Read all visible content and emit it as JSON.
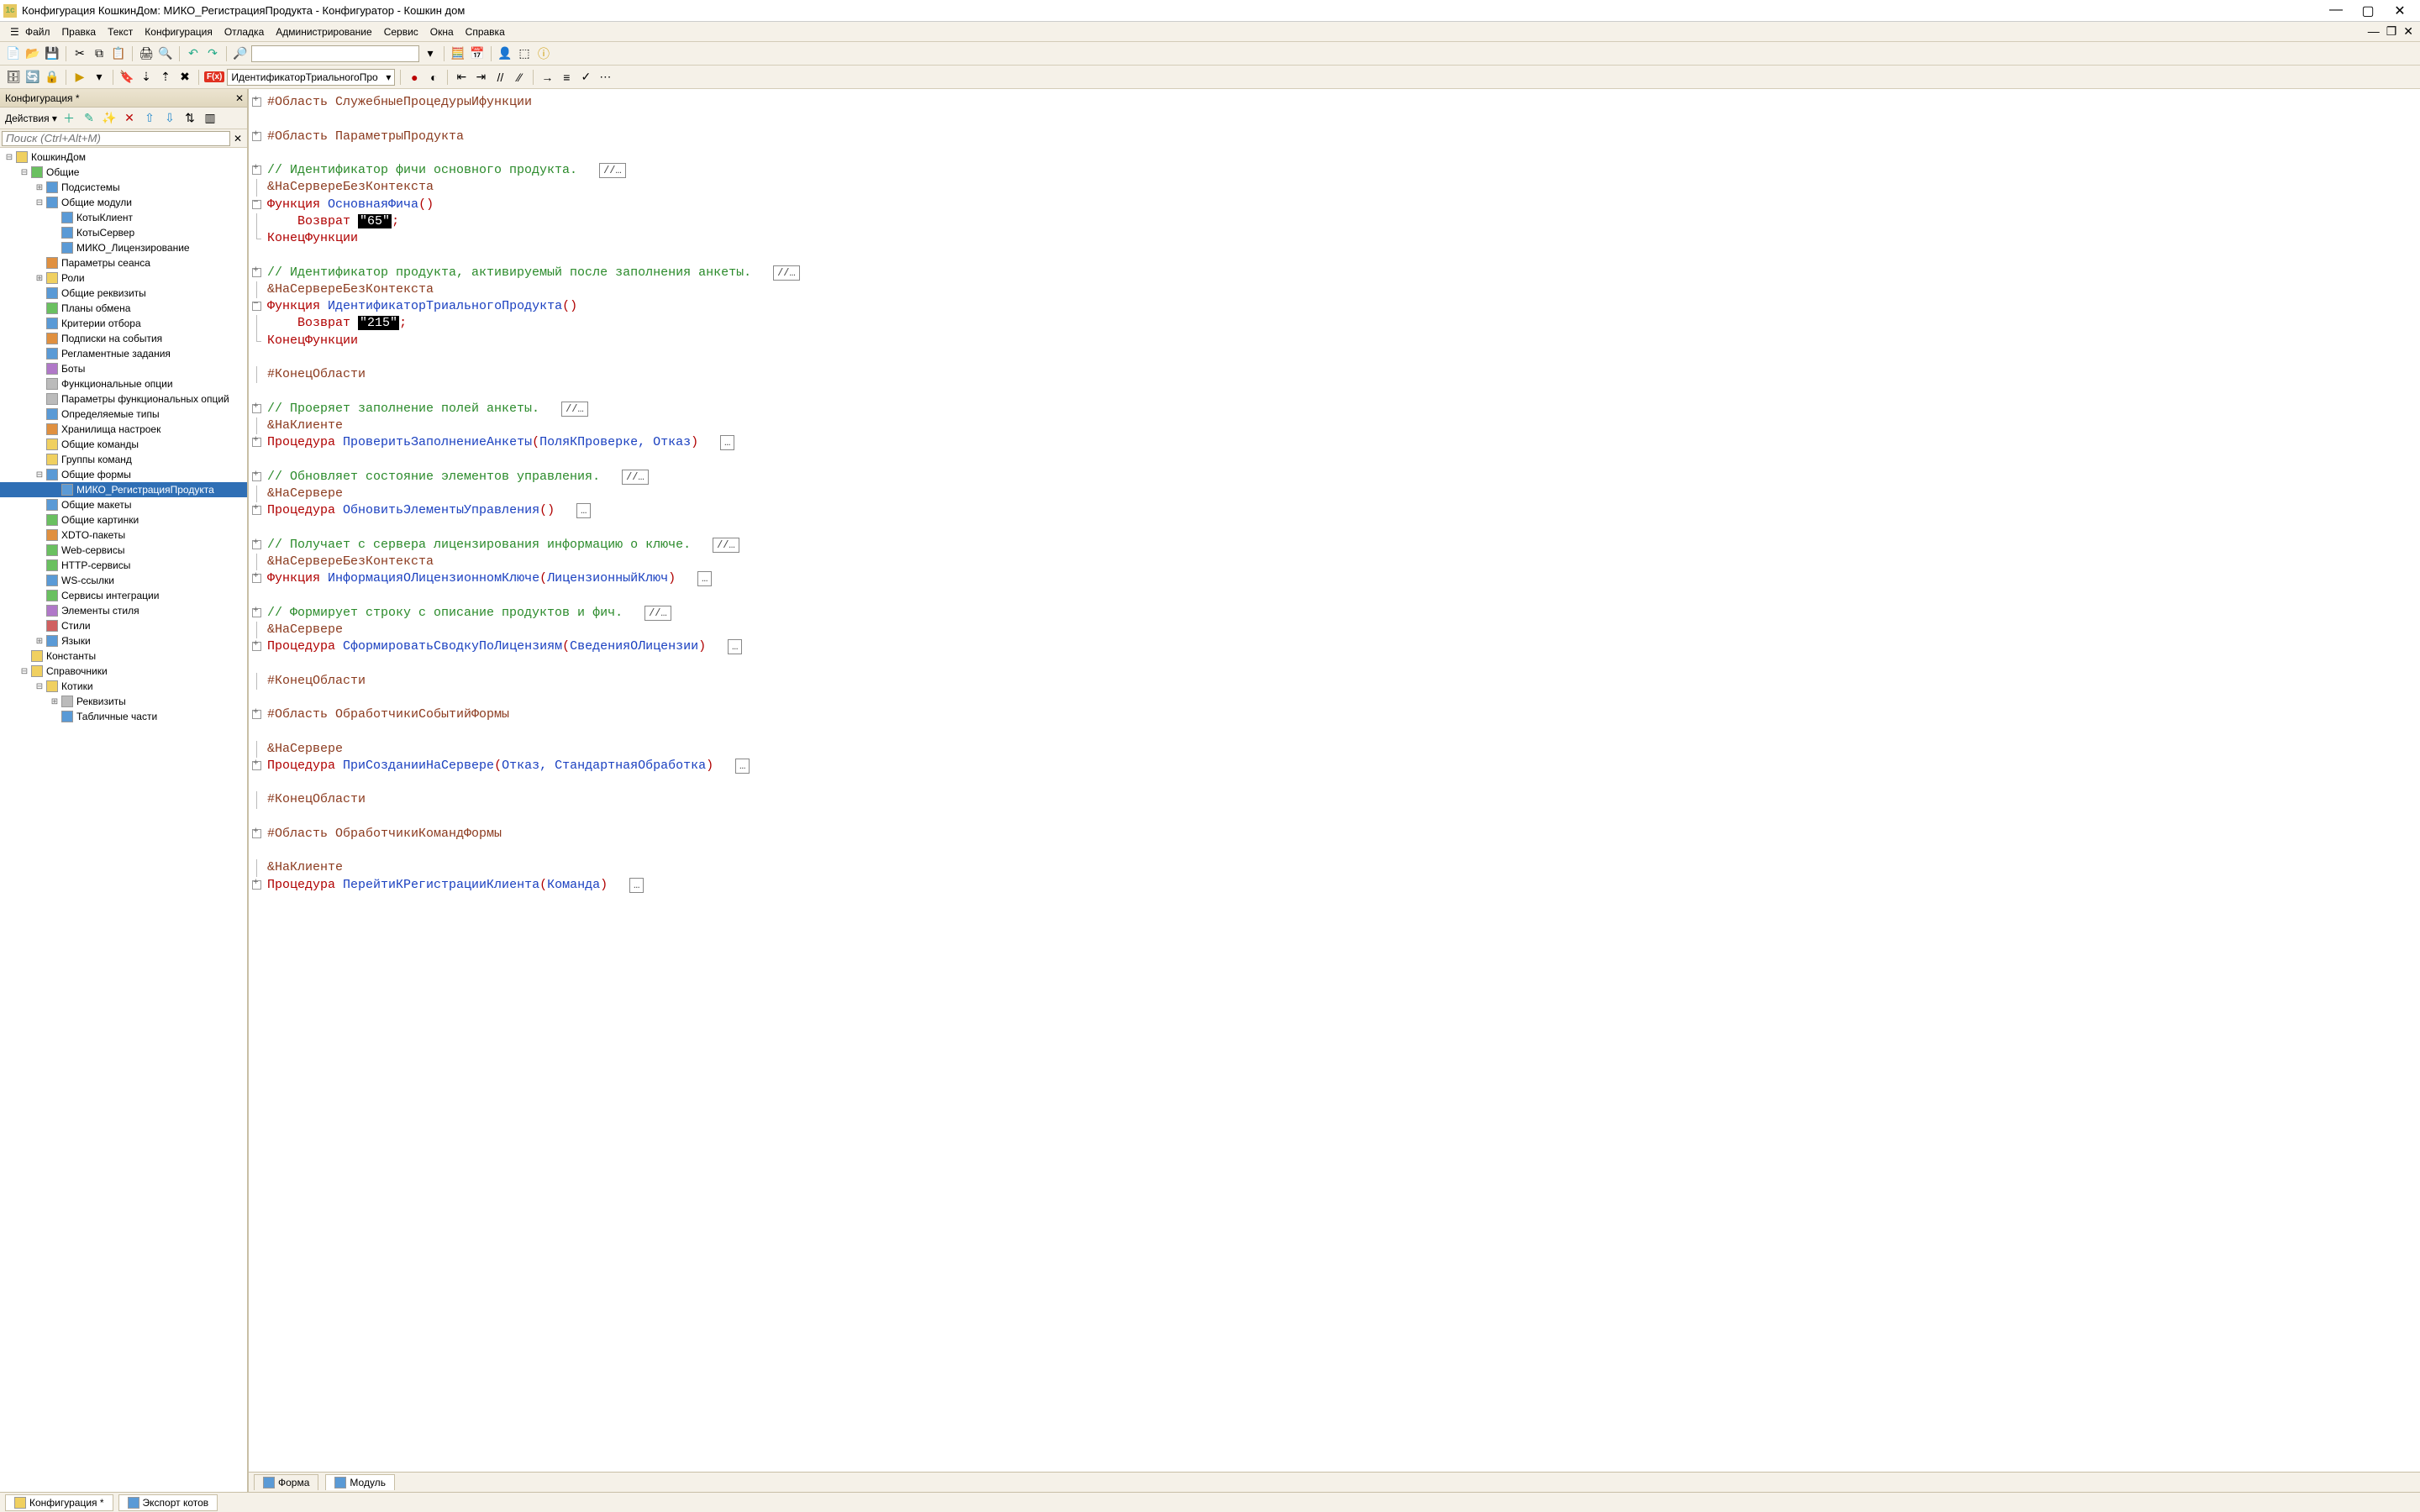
{
  "window": {
    "title": "Конфигурация КошкинДом: МИКО_РегистрацияПродукта - Конфигуратор - Кошкин дом"
  },
  "menu": {
    "items": [
      "Файл",
      "Правка",
      "Текст",
      "Конфигурация",
      "Отладка",
      "Администрирование",
      "Сервис",
      "Окна",
      "Справка"
    ]
  },
  "toolbar2": {
    "func_combo": "ИдентификаторТриальногоПро"
  },
  "sidebar": {
    "title": "Конфигурация *",
    "actions_label": "Действия",
    "search_placeholder": "Поиск (Ctrl+Alt+M)",
    "tree": [
      {
        "depth": 0,
        "exp": "-",
        "icon": "y",
        "label": "КошкинДом"
      },
      {
        "depth": 1,
        "exp": "-",
        "icon": "g",
        "label": "Общие"
      },
      {
        "depth": 2,
        "exp": "+",
        "icon": "b",
        "label": "Подсистемы"
      },
      {
        "depth": 2,
        "exp": "-",
        "icon": "b",
        "label": "Общие модули"
      },
      {
        "depth": 3,
        "exp": "",
        "icon": "b",
        "label": "КотыКлиент"
      },
      {
        "depth": 3,
        "exp": "",
        "icon": "b",
        "label": "КотыСервер"
      },
      {
        "depth": 3,
        "exp": "",
        "icon": "b",
        "label": "МИКО_Лицензирование"
      },
      {
        "depth": 2,
        "exp": "",
        "icon": "o",
        "label": "Параметры сеанса"
      },
      {
        "depth": 2,
        "exp": "+",
        "icon": "y",
        "label": "Роли"
      },
      {
        "depth": 2,
        "exp": "",
        "icon": "b",
        "label": "Общие реквизиты"
      },
      {
        "depth": 2,
        "exp": "",
        "icon": "g",
        "label": "Планы обмена"
      },
      {
        "depth": 2,
        "exp": "",
        "icon": "b",
        "label": "Критерии отбора"
      },
      {
        "depth": 2,
        "exp": "",
        "icon": "o",
        "label": "Подписки на события"
      },
      {
        "depth": 2,
        "exp": "",
        "icon": "b",
        "label": "Регламентные задания"
      },
      {
        "depth": 2,
        "exp": "",
        "icon": "p",
        "label": "Боты"
      },
      {
        "depth": 2,
        "exp": "",
        "icon": "gr",
        "label": "Функциональные опции"
      },
      {
        "depth": 2,
        "exp": "",
        "icon": "gr",
        "label": "Параметры функциональных опций"
      },
      {
        "depth": 2,
        "exp": "",
        "icon": "b",
        "label": "Определяемые типы"
      },
      {
        "depth": 2,
        "exp": "",
        "icon": "o",
        "label": "Хранилища настроек"
      },
      {
        "depth": 2,
        "exp": "",
        "icon": "y",
        "label": "Общие команды"
      },
      {
        "depth": 2,
        "exp": "",
        "icon": "y",
        "label": "Группы команд"
      },
      {
        "depth": 2,
        "exp": "-",
        "icon": "b",
        "label": "Общие формы"
      },
      {
        "depth": 3,
        "exp": "",
        "icon": "b",
        "label": "МИКО_РегистрацияПродукта",
        "selected": true
      },
      {
        "depth": 2,
        "exp": "",
        "icon": "b",
        "label": "Общие макеты"
      },
      {
        "depth": 2,
        "exp": "",
        "icon": "g",
        "label": "Общие картинки"
      },
      {
        "depth": 2,
        "exp": "",
        "icon": "o",
        "label": "XDTO-пакеты"
      },
      {
        "depth": 2,
        "exp": "",
        "icon": "g",
        "label": "Web-сервисы"
      },
      {
        "depth": 2,
        "exp": "",
        "icon": "g",
        "label": "HTTP-сервисы"
      },
      {
        "depth": 2,
        "exp": "",
        "icon": "b",
        "label": "WS-ссылки"
      },
      {
        "depth": 2,
        "exp": "",
        "icon": "g",
        "label": "Сервисы интеграции"
      },
      {
        "depth": 2,
        "exp": "",
        "icon": "p",
        "label": "Элементы стиля"
      },
      {
        "depth": 2,
        "exp": "",
        "icon": "r",
        "label": "Стили"
      },
      {
        "depth": 2,
        "exp": "+",
        "icon": "b",
        "label": "Языки"
      },
      {
        "depth": 1,
        "exp": "",
        "icon": "y",
        "label": "Константы"
      },
      {
        "depth": 1,
        "exp": "-",
        "icon": "y",
        "label": "Справочники"
      },
      {
        "depth": 2,
        "exp": "-",
        "icon": "y",
        "label": "Котики"
      },
      {
        "depth": 3,
        "exp": "+",
        "icon": "gr",
        "label": "Реквизиты"
      },
      {
        "depth": 3,
        "exp": "",
        "icon": "b",
        "label": "Табличные части"
      }
    ]
  },
  "code": {
    "lines": [
      {
        "fold": "plus",
        "html": "<span class='c-dir'>#Область СлужебныеПроцедурыИфункции</span>"
      },
      {
        "fold": "",
        "html": ""
      },
      {
        "fold": "plus",
        "html": "<span class='c-dir'>#Область ПараметрыПродукта</span>"
      },
      {
        "fold": "",
        "html": ""
      },
      {
        "fold": "plus",
        "html": "<span class='c-cmt'>// Идентификатор фичи основного продукта.</span>  <span class='foldbadge'>//…</span>"
      },
      {
        "fold": "pipe",
        "html": "<span class='c-dir'>&amp;НаСервереБезКонтекста</span>"
      },
      {
        "fold": "minus",
        "html": "<span class='c-kw'>Функция</span> <span class='c-id'>ОсновнаяФича</span><span class='c-punc'>()</span>"
      },
      {
        "fold": "pipe",
        "html": "    <span class='c-kw'>Возврат</span> <span class='c-str'>\"65\"</span><span class='c-punc'>;</span>"
      },
      {
        "fold": "end",
        "html": "<span class='c-kw'>КонецФункции</span>"
      },
      {
        "fold": "",
        "html": ""
      },
      {
        "fold": "plus",
        "html": "<span class='c-cmt'>// Идентификатор продукта, активируемый после заполнения анкеты.</span>  <span class='foldbadge'>//…</span>"
      },
      {
        "fold": "pipe",
        "html": "<span class='c-dir'>&amp;НаСервереБезКонтекста</span>"
      },
      {
        "fold": "minus",
        "html": "<span class='c-kw'>Функция</span> <span class='c-id'>ИдентификаторТриальногоПродукта</span><span class='c-punc'>()</span>"
      },
      {
        "fold": "pipe",
        "html": "    <span class='c-kw'>Возврат</span> <span class='c-str'>\"215\"</span><span class='c-punc'>;</span>"
      },
      {
        "fold": "end",
        "html": "<span class='c-kw'>КонецФункции</span>"
      },
      {
        "fold": "",
        "html": ""
      },
      {
        "fold": "pipe",
        "html": "<span class='c-dir'>#КонецОбласти</span>"
      },
      {
        "fold": "",
        "html": ""
      },
      {
        "fold": "plus",
        "html": "<span class='c-cmt'>// Проеряет заполнение полей анкеты.</span>  <span class='foldbadge'>//…</span>"
      },
      {
        "fold": "pipe",
        "html": "<span class='c-dir'>&amp;НаКлиенте</span>"
      },
      {
        "fold": "plus",
        "html": "<span class='c-kw'>Процедура</span> <span class='c-id'>ПроверитьЗаполнениеАнкеты</span><span class='c-punc'>(</span><span class='c-id'>ПоляКПроверке, Отказ</span><span class='c-punc'>)</span>  <span class='foldbadge'>…</span>"
      },
      {
        "fold": "",
        "html": ""
      },
      {
        "fold": "plus",
        "html": "<span class='c-cmt'>// Обновляет состояние элементов управления.</span>  <span class='foldbadge'>//…</span>"
      },
      {
        "fold": "pipe",
        "html": "<span class='c-dir'>&amp;НаСервере</span>"
      },
      {
        "fold": "plus",
        "html": "<span class='c-kw'>Процедура</span> <span class='c-id'>ОбновитьЭлементыУправления</span><span class='c-punc'>()</span>  <span class='foldbadge'>…</span>"
      },
      {
        "fold": "",
        "html": ""
      },
      {
        "fold": "plus",
        "html": "<span class='c-cmt'>// Получает с сервера лицензирования информацию о ключе.</span>  <span class='foldbadge'>//…</span>"
      },
      {
        "fold": "pipe",
        "html": "<span class='c-dir'>&amp;НаСервереБезКонтекста</span>"
      },
      {
        "fold": "plus",
        "html": "<span class='c-kw'>Функция</span> <span class='c-id'>ИнформацияОЛицензионномКлюче</span><span class='c-punc'>(</span><span class='c-id'>ЛицензионныйКлюч</span><span class='c-punc'>)</span>  <span class='foldbadge'>…</span>"
      },
      {
        "fold": "",
        "html": ""
      },
      {
        "fold": "plus",
        "html": "<span class='c-cmt'>// Формирует строку с описание продуктов и фич.</span>  <span class='foldbadge'>//…</span>"
      },
      {
        "fold": "pipe",
        "html": "<span class='c-dir'>&amp;НаСервере</span>"
      },
      {
        "fold": "plus",
        "html": "<span class='c-kw'>Процедура</span> <span class='c-id'>СформироватьСводкуПоЛицензиям</span><span class='c-punc'>(</span><span class='c-id'>СведенияОЛицензии</span><span class='c-punc'>)</span>  <span class='foldbadge'>…</span>"
      },
      {
        "fold": "",
        "html": ""
      },
      {
        "fold": "pipe",
        "html": "<span class='c-dir'>#КонецОбласти</span>"
      },
      {
        "fold": "",
        "html": ""
      },
      {
        "fold": "plus",
        "html": "<span class='c-dir'>#Область ОбработчикиСобытийФормы</span>"
      },
      {
        "fold": "",
        "html": ""
      },
      {
        "fold": "pipe",
        "html": "<span class='c-dir'>&amp;НаСервере</span>"
      },
      {
        "fold": "plus",
        "html": "<span class='c-kw'>Процедура</span> <span class='c-id'>ПриСозданииНаСервере</span><span class='c-punc'>(</span><span class='c-id'>Отказ, СтандартнаяОбработка</span><span class='c-punc'>)</span>  <span class='foldbadge'>…</span>"
      },
      {
        "fold": "",
        "html": ""
      },
      {
        "fold": "pipe",
        "html": "<span class='c-dir'>#КонецОбласти</span>"
      },
      {
        "fold": "",
        "html": ""
      },
      {
        "fold": "plus",
        "html": "<span class='c-dir'>#Область ОбработчикиКомандФормы</span>"
      },
      {
        "fold": "",
        "html": ""
      },
      {
        "fold": "pipe",
        "html": "<span class='c-dir'>&amp;НаКлиенте</span>"
      },
      {
        "fold": "plus",
        "html": "<span class='c-kw'>Процедура</span> <span class='c-id'>ПерейтиКРегистрацииКлиента</span><span class='c-punc'>(</span><span class='c-id'>Команда</span><span class='c-punc'>)</span>  <span class='foldbadge'>…</span>"
      }
    ]
  },
  "editor_tabs": [
    {
      "label": "Форма",
      "icon": "b"
    },
    {
      "label": "Модуль",
      "icon": "b",
      "active": true
    }
  ],
  "bottom_tabs": [
    {
      "label": "Конфигурация *",
      "icon": "y"
    },
    {
      "label": "Экспорт котов",
      "icon": "b"
    }
  ]
}
